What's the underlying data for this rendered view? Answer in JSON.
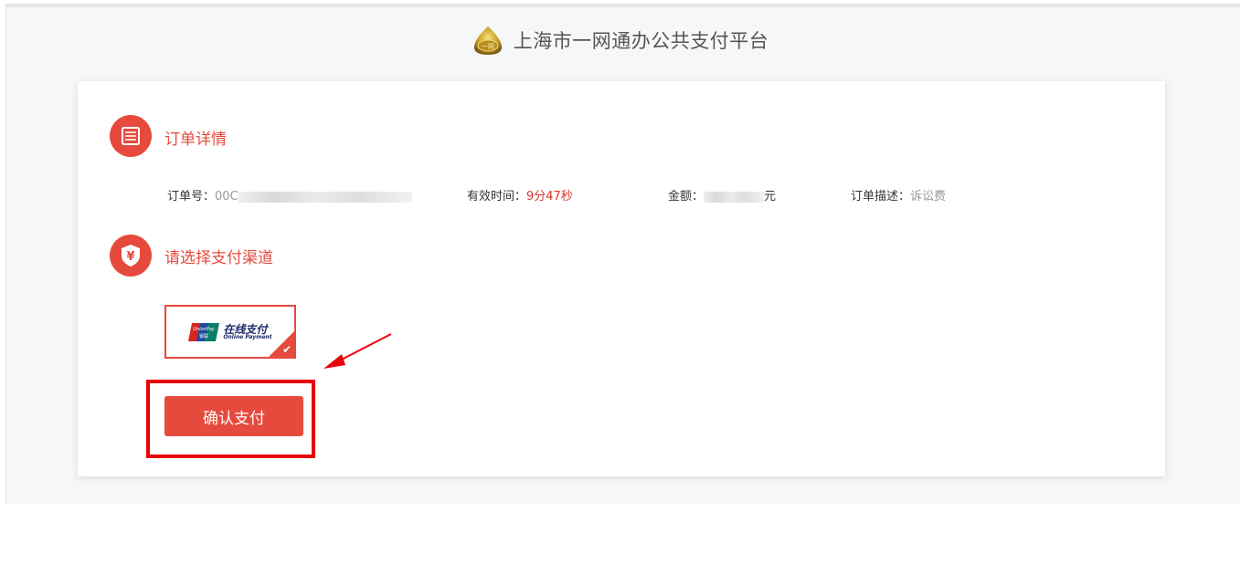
{
  "header": {
    "title": "上海市一网通办公共支付平台",
    "logo_icon": "gold-seal-logo-icon"
  },
  "order_section": {
    "title": "订单详情",
    "icon": "list-icon",
    "fields": {
      "order_no_label": "订单号：",
      "order_no_value": "00C",
      "valid_time_label": "有效时间：",
      "valid_time_value": "9分47秒",
      "amount_label": "金额：",
      "amount_unit": "元",
      "desc_label": "订单描述：",
      "desc_value": "诉讼费"
    }
  },
  "pay_section": {
    "title": "请选择支付渠道",
    "icon": "yuan-shield-icon",
    "channel": {
      "cn": "在线支付",
      "en": "Online Payment",
      "brand": "UnionPay 银联",
      "selected": true
    }
  },
  "confirm_button": "确认支付",
  "colors": {
    "accent": "#e64a3c",
    "highlight": "#e8000b"
  }
}
